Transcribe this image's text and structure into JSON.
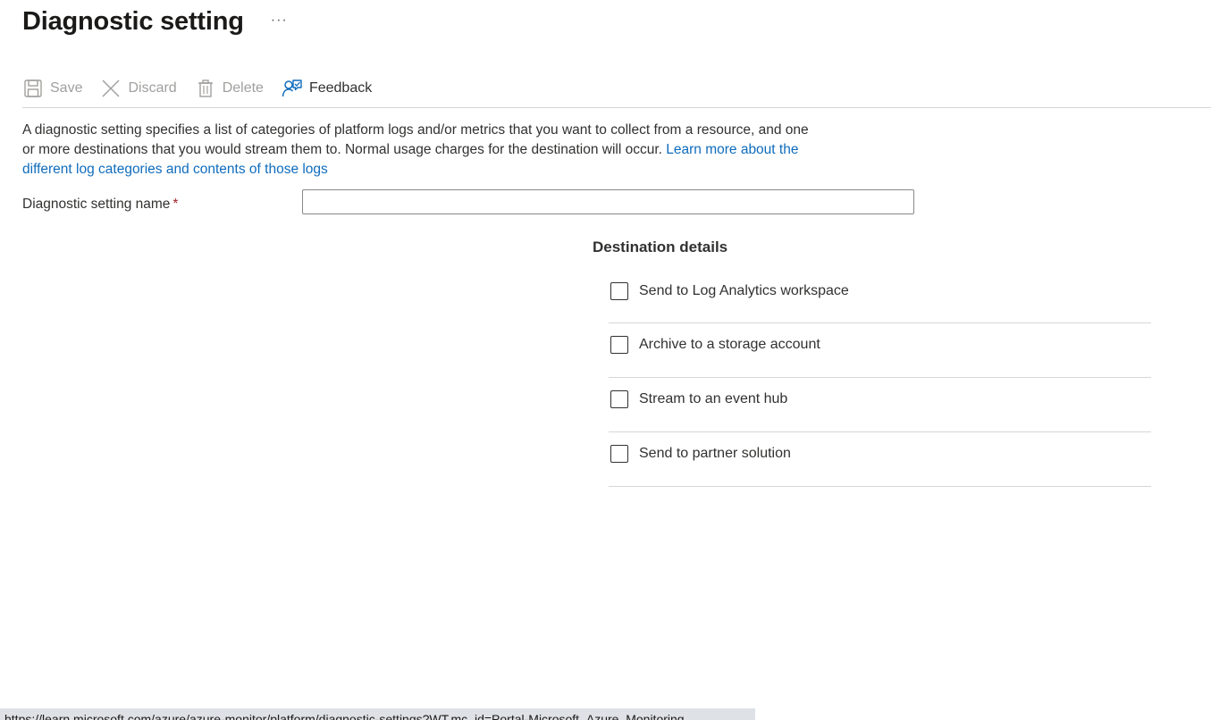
{
  "header": {
    "title": "Diagnostic setting",
    "more_label": "···"
  },
  "toolbar": {
    "save_label": "Save",
    "discard_label": "Discard",
    "delete_label": "Delete",
    "feedback_label": "Feedback"
  },
  "description": {
    "text": "A diagnostic setting specifies a list of categories of platform logs and/or metrics that you want to collect from a resource, and one or more destinations that you would stream them to. Normal usage charges for the destination will occur. ",
    "link_text": "Learn more about the different log categories and contents of those logs"
  },
  "form": {
    "name_label": "Diagnostic setting name",
    "required_marker": "*",
    "name_value": ""
  },
  "destinations": {
    "heading": "Destination details",
    "items": [
      {
        "label": "Send to Log Analytics workspace",
        "checked": false
      },
      {
        "label": "Archive to a storage account",
        "checked": false
      },
      {
        "label": "Stream to an event hub",
        "checked": false
      },
      {
        "label": "Send to partner solution",
        "checked": false
      }
    ]
  },
  "status_bar": {
    "url": "https://learn.microsoft.com/azure/azure-monitor/platform/diagnostic-settings?WT.mc_id=Portal-Microsoft_Azure_Monitoring"
  },
  "icons": {
    "save": "save-icon",
    "discard": "close-icon",
    "delete": "trash-icon",
    "feedback": "feedback-icon"
  },
  "colors": {
    "link": "#0f6cbd",
    "required": "#a4262c",
    "disabled_text": "#a19f9d",
    "feedback_icon": "#0f6cbd"
  }
}
